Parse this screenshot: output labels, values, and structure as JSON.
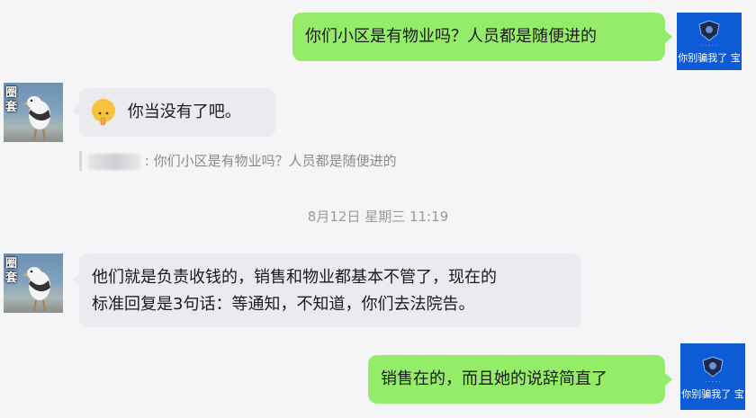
{
  "messages": [
    {
      "id": "m1",
      "side": "right",
      "text": "你们小区是有物业吗？人员都是随便进的"
    },
    {
      "id": "m2",
      "side": "left",
      "emoji": "shushing-face-icon",
      "text": "你当没有了吧。",
      "quote": ": 你们小区是有物业吗？人员都是随便进的"
    },
    {
      "id": "m3",
      "side": "left",
      "text_lines": [
        "他们就是负责收钱的，销售和物业都基本不管了，现在的",
        "标准回复是3句话：等通知，不知道，你们去法院告。"
      ]
    },
    {
      "id": "m4",
      "side": "right",
      "text": "销售在的，而且她的说辞简直了"
    }
  ],
  "timestamp": "8月12日 星期三 11:19",
  "avatars": {
    "right_caption": "你别骗我了 宝",
    "left_label": "圈套"
  },
  "colors": {
    "outgoing": "#95ec69",
    "incoming": "#ebebef",
    "avatar_blue": "#0e5bd6"
  }
}
